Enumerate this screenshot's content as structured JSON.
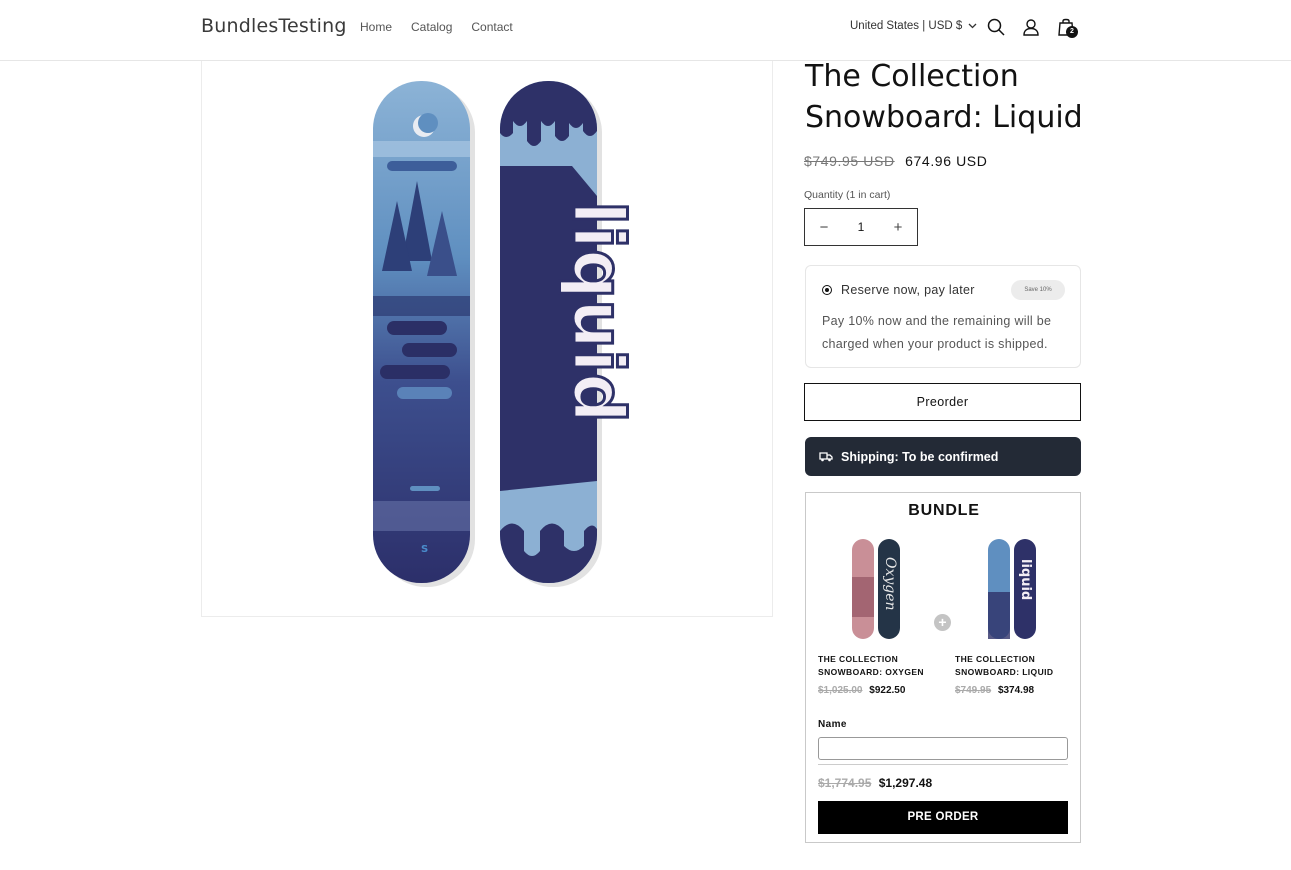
{
  "header": {
    "logo": "BundlesTesting",
    "nav": [
      {
        "label": "Home"
      },
      {
        "label": "Catalog"
      },
      {
        "label": "Contact"
      }
    ],
    "country": "United States | USD $",
    "cart_count": "2"
  },
  "product": {
    "title": "The Collection Snowboard: Liquid",
    "price_compare": "$749.95 USD",
    "price": "674.96 USD",
    "quantity_label": "Quantity (1 in cart)",
    "quantity": "1",
    "media": {
      "board_left_logo": "S",
      "board_right_text": "liquid"
    }
  },
  "reserve": {
    "label": "Reserve now, pay later",
    "badge": "Save 10%",
    "description": "Pay 10% now and the remaining will be charged when your product is shipped."
  },
  "preorder_button": "Preorder",
  "shipping": {
    "label": "Shipping: To be confirmed"
  },
  "bundle": {
    "title": "BUNDLE",
    "products": [
      {
        "name": "THE COLLECTION SNOWBOARD: OXYGEN",
        "price_compare": "$1,025.00",
        "price": "$922.50",
        "board_text": "Oxygen"
      },
      {
        "name": "THE COLLECTION SNOWBOARD: LIQUID",
        "price_compare": "$749.95",
        "price": "$374.98",
        "board_text": "liquid"
      }
    ],
    "plus_symbol": "+",
    "name_label": "Name",
    "total_compare": "$1,774.95",
    "total": "$1,297.48",
    "button": "PRE ORDER"
  },
  "colors": {
    "shipping_bg": "#232a36",
    "board_blue_light": "#7fa8cf",
    "board_navy": "#2e3168",
    "oxygen_pink": "#c98f97"
  }
}
